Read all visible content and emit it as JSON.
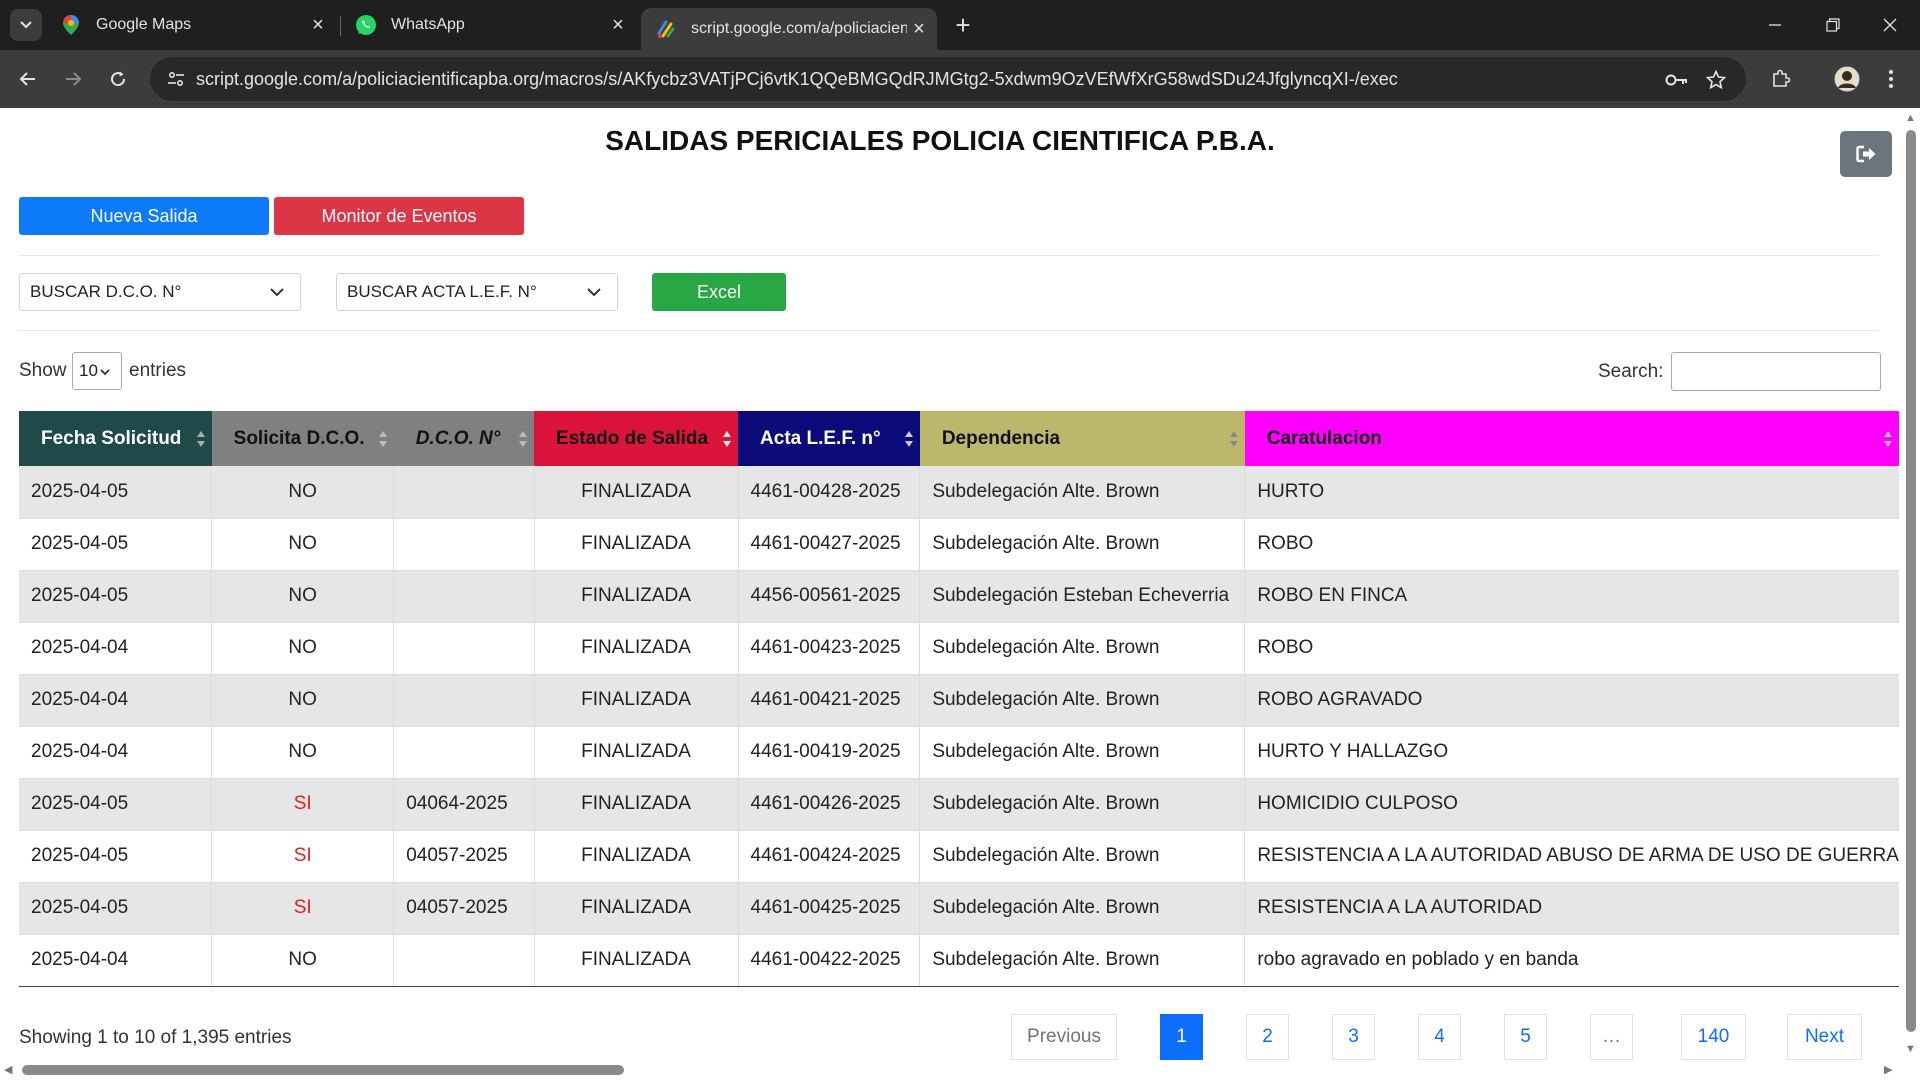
{
  "browser": {
    "tabs": [
      {
        "title": "Google Maps",
        "icon": "google-maps-icon"
      },
      {
        "title": "WhatsApp",
        "icon": "whatsapp-icon"
      },
      {
        "title": "script.google.com/a/policiacien",
        "icon": "apps-script-icon",
        "active": true
      }
    ],
    "url": "script.google.com/a/policiacientificapba.org/macros/s/AKfycbz3VATjPCj6vtK1QQeBMGQdRJMGtg2-5xdwm9OzVEfWfXrG58wdSDu24JfglyncqXI-/exec"
  },
  "page": {
    "title": "SALIDAS PERICIALES POLICIA CIENTIFICA P.B.A.",
    "buttons": {
      "new": "Nueva Salida",
      "monitor": "Monitor de Eventos",
      "excel": "Excel"
    },
    "filters": {
      "dco": "BUSCAR D.C.O. N°",
      "acta": "BUSCAR ACTA L.E.F. N°"
    },
    "length": {
      "show": "Show",
      "value": "10",
      "entries": "entries"
    },
    "search_label": "Search:",
    "colors": {
      "primary": "#0d7af7",
      "danger": "#dc3545",
      "success": "#28a745",
      "si_text": "#e02020"
    }
  },
  "table": {
    "headers": [
      {
        "label": "Fecha Solicitud",
        "bg": "#1e4a4a",
        "color": "#ffffff"
      },
      {
        "label": "Solicita D.C.O.",
        "bg": "#808080",
        "color": "#111111"
      },
      {
        "label": "D.C.O. N°",
        "bg": "#808080",
        "color": "#111111",
        "italic": true
      },
      {
        "label": "Estado de Salida",
        "bg": "#dc143c",
        "color": "#111111"
      },
      {
        "label": "Acta L.E.F. n°",
        "bg": "#0a0a78",
        "color": "#ffffff"
      },
      {
        "label": "Dependencia",
        "bg": "#bdb76b",
        "color": "#111111"
      },
      {
        "label": "Caratulacion",
        "bg": "#ff00ff",
        "color": "#111111"
      }
    ],
    "rows": [
      [
        "2025-04-05",
        "NO",
        "",
        "FINALIZADA",
        "4461-00428-2025",
        "Subdelegación Alte. Brown",
        "HURTO"
      ],
      [
        "2025-04-05",
        "NO",
        "",
        "FINALIZADA",
        "4461-00427-2025",
        "Subdelegación Alte. Brown",
        "ROBO"
      ],
      [
        "2025-04-05",
        "NO",
        "",
        "FINALIZADA",
        "4456-00561-2025",
        "Subdelegación Esteban Echeverria",
        "ROBO EN FINCA"
      ],
      [
        "2025-04-04",
        "NO",
        "",
        "FINALIZADA",
        "4461-00423-2025",
        "Subdelegación Alte. Brown",
        "ROBO"
      ],
      [
        "2025-04-04",
        "NO",
        "",
        "FINALIZADA",
        "4461-00421-2025",
        "Subdelegación Alte. Brown",
        "ROBO AGRAVADO"
      ],
      [
        "2025-04-04",
        "NO",
        "",
        "FINALIZADA",
        "4461-00419-2025",
        "Subdelegación Alte. Brown",
        "HURTO Y HALLAZGO"
      ],
      [
        "2025-04-05",
        "SI",
        "04064-2025",
        "FINALIZADA",
        "4461-00426-2025",
        "Subdelegación Alte. Brown",
        "HOMICIDIO CULPOSO"
      ],
      [
        "2025-04-05",
        "SI",
        "04057-2025",
        "FINALIZADA",
        "4461-00424-2025",
        "Subdelegación Alte. Brown",
        "RESISTENCIA A LA AUTORIDAD ABUSO DE ARMA DE USO DE GUERRA"
      ],
      [
        "2025-04-05",
        "SI",
        "04057-2025",
        "FINALIZADA",
        "4461-00425-2025",
        "Subdelegación Alte. Brown",
        "RESISTENCIA A LA AUTORIDAD"
      ],
      [
        "2025-04-04",
        "NO",
        "",
        "FINALIZADA",
        "4461-00422-2025",
        "Subdelegación Alte. Brown",
        "robo agravado en poblado y en banda"
      ]
    ]
  },
  "footer": {
    "info": "Showing 1 to 10 of 1,395 entries",
    "pagination": [
      "Previous",
      "1",
      "2",
      "3",
      "4",
      "5",
      "…",
      "140",
      "Next"
    ],
    "current_page": "1"
  }
}
